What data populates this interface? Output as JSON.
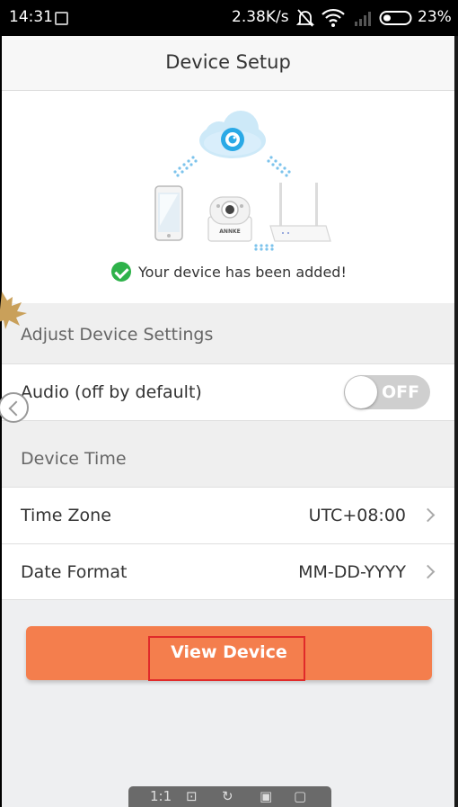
{
  "status_bar": {
    "time": "14:31",
    "net_speed": "2.38K/s",
    "battery": "23%"
  },
  "nav": {
    "title": "Device Setup"
  },
  "hero": {
    "message": "Your device has been added!",
    "camera_brand": "ANNKE"
  },
  "settings": {
    "section_title": "Adjust Device Settings",
    "audio_label": "Audio (off by default)",
    "audio_toggle_text": "OFF",
    "audio_enabled": false
  },
  "device_time": {
    "section_title": "Device Time",
    "rows": [
      {
        "label": "Time Zone",
        "value": "UTC+08:00"
      },
      {
        "label": "Date Format",
        "value": "MM-DD-YYYY"
      }
    ]
  },
  "actions": {
    "view_device": "View Device"
  },
  "viewer_toolbar": {
    "zoom": "1:1"
  },
  "colors": {
    "accent": "#f47e4d",
    "success": "#2eb24a",
    "highlight_outline": "#e02a2a",
    "cloud": "#2aa9e6"
  }
}
